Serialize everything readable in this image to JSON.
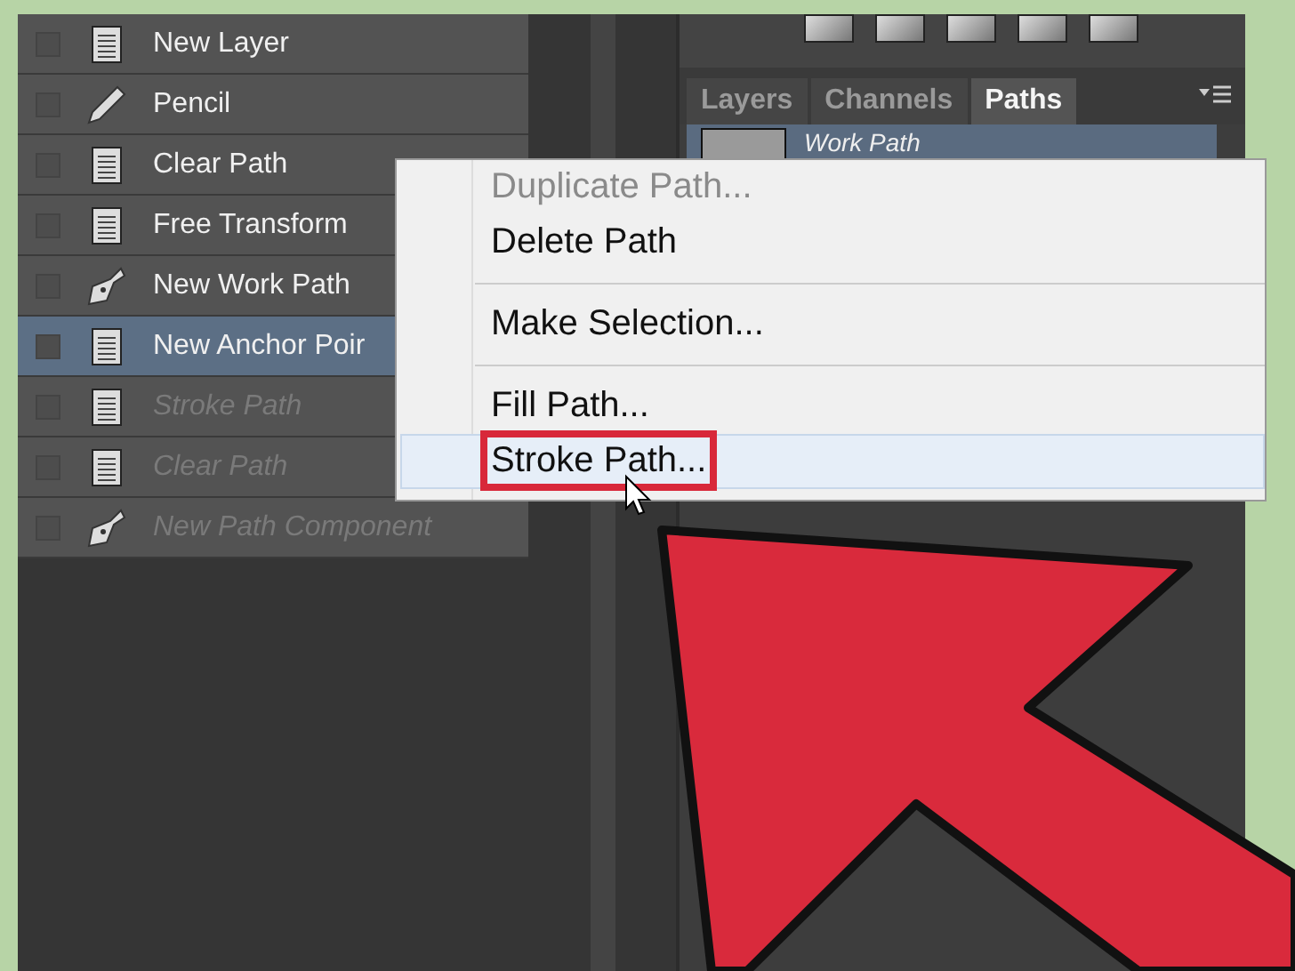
{
  "history": {
    "items": [
      {
        "label": "New Layer",
        "kind": "doc",
        "selected": false,
        "disabled": false
      },
      {
        "label": "Pencil",
        "kind": "pencil",
        "selected": false,
        "disabled": false
      },
      {
        "label": "Clear Path",
        "kind": "doc",
        "selected": false,
        "disabled": false
      },
      {
        "label": "Free Transform",
        "kind": "doc",
        "selected": false,
        "disabled": false
      },
      {
        "label": "New Work Path",
        "kind": "pen",
        "selected": false,
        "disabled": false
      },
      {
        "label": "New Anchor Poir",
        "kind": "doc",
        "selected": true,
        "disabled": false
      },
      {
        "label": "Stroke Path",
        "kind": "doc",
        "selected": false,
        "disabled": true
      },
      {
        "label": "Clear Path",
        "kind": "doc",
        "selected": false,
        "disabled": true
      },
      {
        "label": "New Path Component",
        "kind": "pen",
        "selected": false,
        "disabled": true
      }
    ]
  },
  "panel": {
    "tabs": [
      {
        "label": "Layers",
        "selected": false
      },
      {
        "label": "Channels",
        "selected": false
      },
      {
        "label": "Paths",
        "selected": true
      }
    ],
    "paths": [
      {
        "name": "Work Path",
        "selected": true
      }
    ]
  },
  "context_menu": {
    "groups": [
      [
        {
          "label": "Duplicate Path...",
          "disabled": true,
          "selected": false
        },
        {
          "label": "Delete Path",
          "disabled": false,
          "selected": false
        }
      ],
      [
        {
          "label": "Make Selection...",
          "disabled": false,
          "selected": false
        }
      ],
      [
        {
          "label": "Fill Path...",
          "disabled": false,
          "selected": false
        },
        {
          "label": "Stroke Path...",
          "disabled": false,
          "selected": true
        }
      ]
    ]
  }
}
